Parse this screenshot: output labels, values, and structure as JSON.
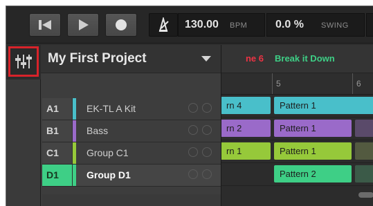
{
  "transport": {
    "buttons": [
      {
        "name": "restart-button",
        "icon": "skip-to-start-icon"
      },
      {
        "name": "play-button",
        "icon": "play-icon"
      },
      {
        "name": "record-button",
        "icon": "record-icon"
      }
    ],
    "metronome_icon": "metronome-icon",
    "tempo_value": "130.00",
    "tempo_unit": "BPM",
    "swing_value": "0.0 %",
    "swing_unit": "SWING"
  },
  "mixer_button": {
    "icon": "mixer-faders-icon",
    "highlight_color": "#d8232a"
  },
  "panel": {
    "project_name": "My First Project",
    "dropdown_icon": "dropdown-arrow-icon",
    "groups": [
      {
        "id": "A1",
        "name": "EK-TL A Kit",
        "color": "#49bfca",
        "selected": false
      },
      {
        "id": "B1",
        "name": "Bass",
        "color": "#9a6ac9",
        "selected": false
      },
      {
        "id": "C1",
        "name": "Group C1",
        "color": "#96c93a",
        "selected": false
      },
      {
        "id": "D1",
        "name": "Group D1",
        "color": "#3ecf86",
        "selected": true
      }
    ]
  },
  "arranger": {
    "scenes": [
      {
        "label": "ne 6",
        "color": "#ee3344"
      },
      {
        "label": "Break it Down",
        "color": "#3ecf86"
      }
    ],
    "ruler": [
      "5",
      "6"
    ],
    "rows": [
      {
        "left_clip": "rn 4",
        "right_clip": "Pattern 1",
        "color": "#49bfca"
      },
      {
        "left_clip": "rn 2",
        "right_clip": "Pattern 1",
        "color": "#9a6ac9"
      },
      {
        "left_clip": "rn 1",
        "right_clip": "Pattern 1",
        "color": "#96c93a"
      },
      {
        "left_clip": "",
        "right_clip": "Pattern 2",
        "color": "#3ecf86"
      }
    ]
  }
}
